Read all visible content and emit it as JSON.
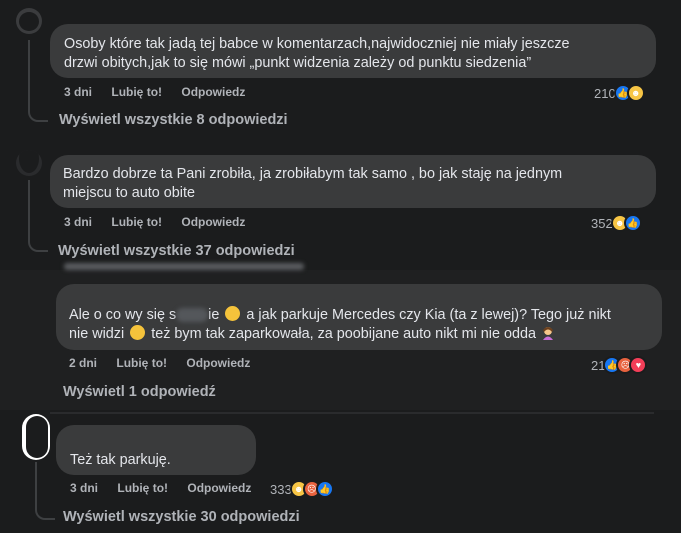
{
  "comments": [
    {
      "text_lines": [
        "Osoby które tak jadą tej babce w komentarzach,najwidoczniej nie miały jeszcze",
        "drzwi obitych,jak to się mówi „punkt widzenia zależy od punktu siedzenia”"
      ],
      "time": "3 dni",
      "like_label": "Lubię to!",
      "reply_label": "Odpowiedz",
      "reaction_count": "210",
      "reactions": [
        "like-icon",
        "haha-icon"
      ],
      "view_replies": "Wyświetl wszystkie 8 odpowiedzi"
    },
    {
      "text_lines": [
        "Bardzo dobrze ta Pani zrobiła, ja zrobiłabym tak samo , bo jak staję na jednym",
        "miejscu to auto obite"
      ],
      "time": "3 dni",
      "like_label": "Lubię to!",
      "reply_label": "Odpowiedz",
      "reaction_count": "352",
      "reactions": [
        "haha-icon",
        "like-icon"
      ],
      "view_replies": "Wyświetl wszystkie 37 odpowiedzi"
    },
    {
      "text_part1": "Ale o co wy się s",
      "text_part2": "ie",
      "text_part3": " a jak parkuje Mercedes czy Kia (ta z lewej)? Tego już nikt",
      "text_line2_a": "nie widzi",
      "text_line2_b": " też bym tak zaparkowała, za poobijane auto nikt mi nie odda",
      "time": "2 dni",
      "like_label": "Lubię to!",
      "reply_label": "Odpowiedz",
      "reaction_count": "21",
      "reactions": [
        "like-icon",
        "angry-icon",
        "love-icon"
      ],
      "view_replies": "Wyświetl 1 odpowiedź"
    },
    {
      "text_lines": [
        "Też tak parkuję."
      ],
      "time": "3 dni",
      "like_label": "Lubię to!",
      "reply_label": "Odpowiedz",
      "reaction_count": "333",
      "reactions": [
        "haha-icon",
        "angry-icon",
        "like-icon"
      ],
      "view_replies": "Wyświetl wszystkie 30 odpowiedzi"
    }
  ],
  "colors": {
    "background": "#18191a",
    "bubble": "#3a3b3c",
    "text": "#e4e6eb",
    "secondary_text": "#b0b3b8",
    "like": "#1877f2",
    "haha": "#f7c545",
    "angry": "#e8623e",
    "love": "#f33e58"
  }
}
